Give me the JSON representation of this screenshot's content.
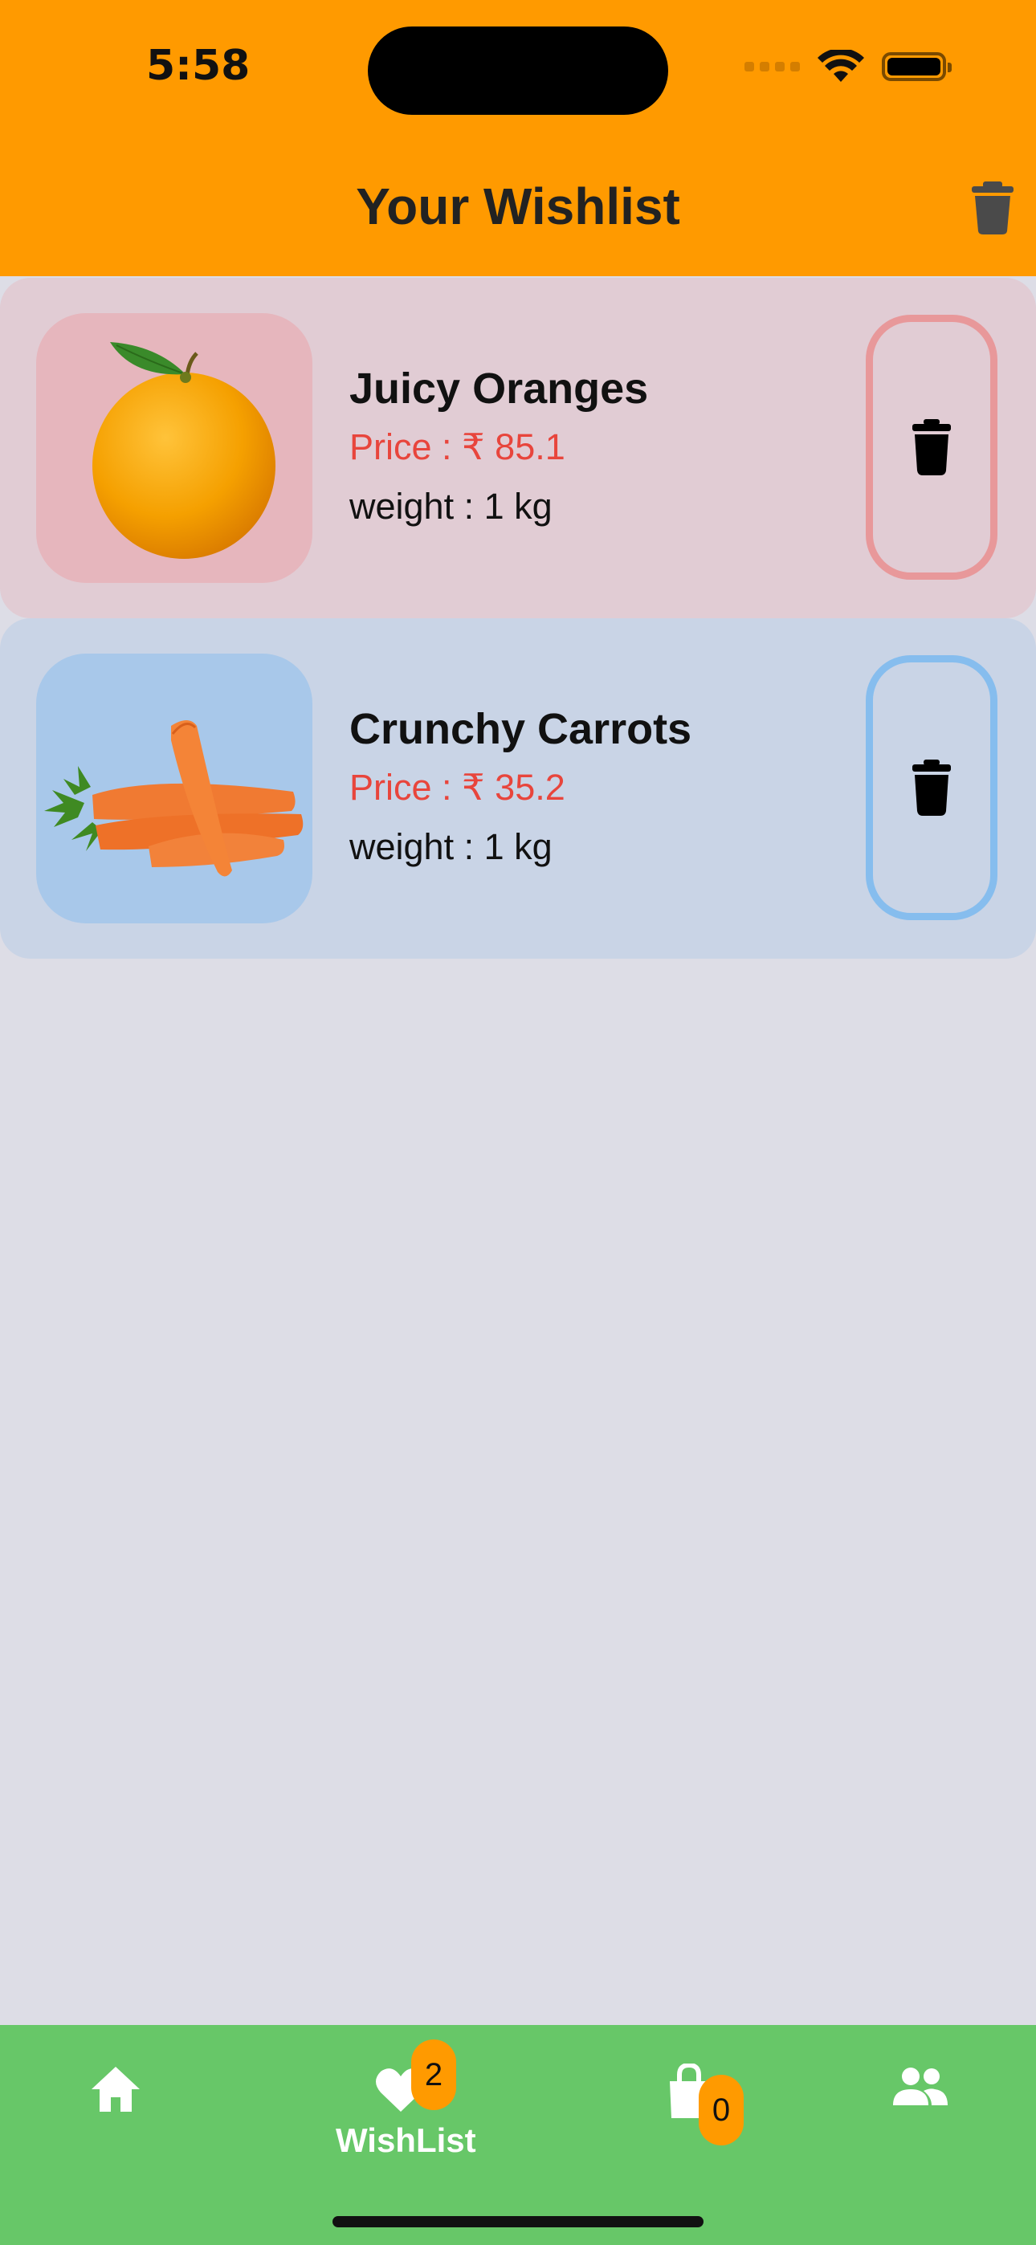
{
  "status_bar": {
    "time": "5:58"
  },
  "header": {
    "title": "Your Wishlist",
    "clear_icon": "trash-icon"
  },
  "wishlist": {
    "items": [
      {
        "name": "Juicy Oranges",
        "price": "Price : ₹ 85.1",
        "weight": "weight : 1 kg",
        "image": "orange-image",
        "card_color": "#e1ccd4",
        "accent_color": "#e8989a"
      },
      {
        "name": "Crunchy Carrots",
        "price": "Price : ₹ 35.2",
        "weight": "weight : 1 kg",
        "image": "carrots-image",
        "card_color": "#c9d4e6",
        "accent_color": "#86bdee"
      }
    ]
  },
  "bottom_nav": {
    "home_icon": "home-icon",
    "wishlist_label": "WishList",
    "wishlist_badge": "2",
    "cart_icon": "shopping-bag-icon",
    "cart_badge": "0",
    "users_icon": "users-icon"
  },
  "colors": {
    "header": "#ff9a00",
    "nav": "#67c768",
    "price": "#e8453c",
    "background": "#dddde6"
  }
}
